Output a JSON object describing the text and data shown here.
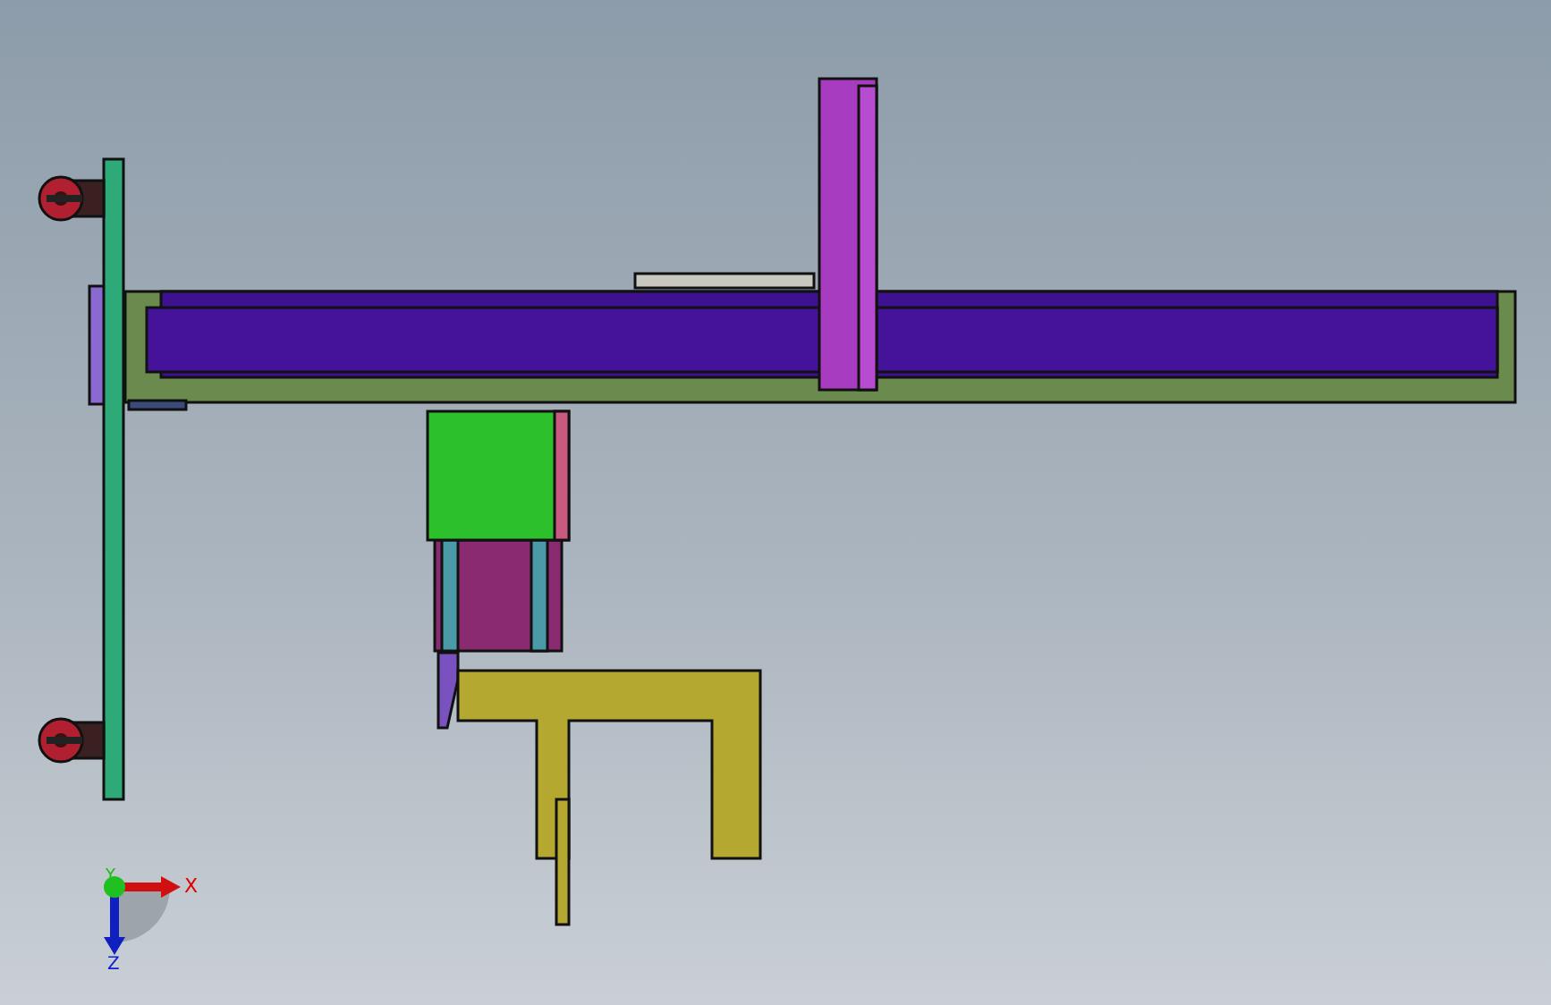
{
  "viewport": {
    "triad": {
      "axes": [
        {
          "kind": "x",
          "label": "X"
        },
        {
          "kind": "y",
          "label": "Y"
        },
        {
          "kind": "z",
          "label": "Z"
        }
      ]
    }
  }
}
